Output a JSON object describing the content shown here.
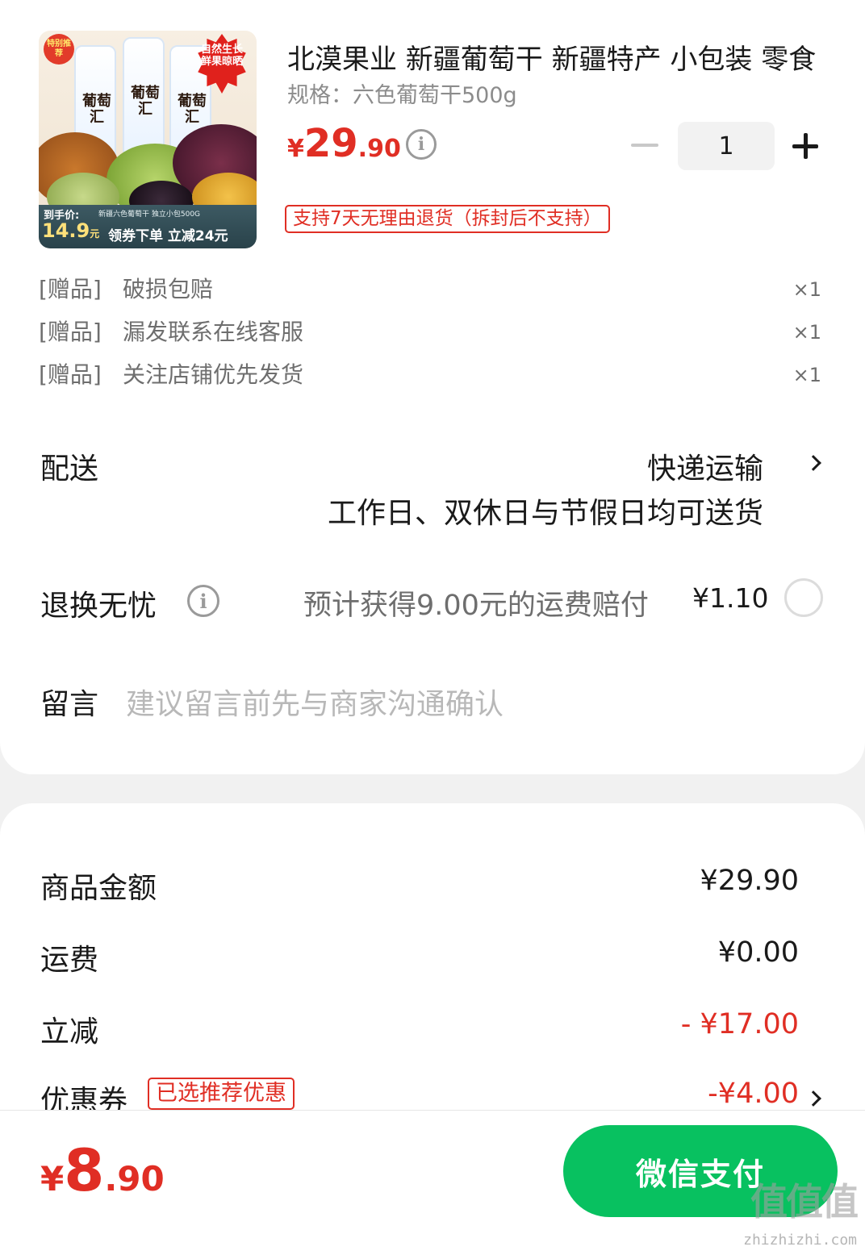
{
  "product": {
    "title": "北漠果业 新疆葡萄干 新疆特产 小包装 零食",
    "spec": "规格：六色葡萄干500g",
    "price_currency": "¥",
    "price_int": "29",
    "price_dec": ".90",
    "quantity": "1",
    "return_policy": "支持7天无理由退货（拆封后不支持）",
    "image": {
      "corner_tag": "特别推荐",
      "starburst": "自然生长 鲜果晾晒",
      "package_text": "葡萄汇",
      "bar_label": "到手价:",
      "bar_price": "14.9",
      "bar_price_unit": "元",
      "bar_sub": "新疆六色葡萄干 独立小包500G",
      "bar_promo": "领券下单 立减24元"
    }
  },
  "gifts": [
    {
      "tag": "[赠品]",
      "name": "破损包赔",
      "count": "×1"
    },
    {
      "tag": "[赠品]",
      "name": "漏发联系在线客服",
      "count": "×1"
    },
    {
      "tag": "[赠品]",
      "name": "关注店铺优先发货",
      "count": "×1"
    }
  ],
  "delivery": {
    "label": "配送",
    "method": "快递运输",
    "note": "工作日、双休日与节假日均可送货"
  },
  "return_insurance": {
    "label": "退换无忧",
    "text": "预计获得9.00元的运费赔付",
    "price": "¥1.10"
  },
  "message": {
    "label": "留言",
    "placeholder": "建议留言前先与商家沟通确认"
  },
  "summary": {
    "goods_label": "商品金额",
    "goods_value": "¥29.90",
    "shipping_label": "运费",
    "shipping_value": "¥0.00",
    "discount_label": "立减",
    "discount_value": "- ¥17.00",
    "coupon_label": "优惠券",
    "coupon_tag": "已选推荐优惠",
    "coupon_value": "-¥4.00"
  },
  "footer": {
    "total_currency": "¥",
    "total_int": "8",
    "total_dec": ".90",
    "pay_label": "微信支付"
  },
  "watermark": {
    "logo": "值值值",
    "domain": "zhizhizhi.com"
  },
  "colors": {
    "accent_red": "#e02e24",
    "pay_green": "#08c160"
  }
}
